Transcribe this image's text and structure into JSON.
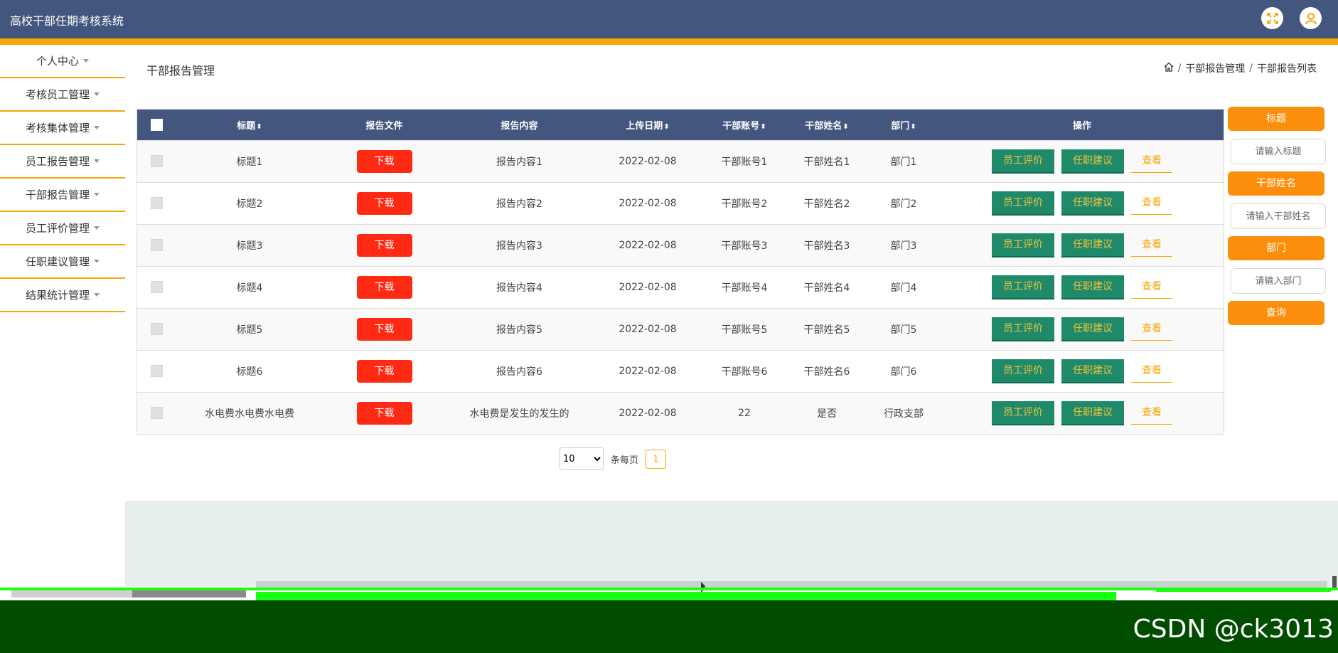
{
  "app": {
    "title": "高校干部任期考核系统"
  },
  "header": {
    "icons": [
      "expand-icon",
      "user-icon"
    ]
  },
  "sidebar": {
    "items": [
      {
        "label": "个人中心"
      },
      {
        "label": "考核员工管理"
      },
      {
        "label": "考核集体管理"
      },
      {
        "label": "员工报告管理"
      },
      {
        "label": "干部报告管理"
      },
      {
        "label": "员工评价管理"
      },
      {
        "label": "任职建议管理"
      },
      {
        "label": "结果统计管理"
      }
    ]
  },
  "page": {
    "title": "干部报告管理",
    "breadcrumb": [
      "干部报告管理",
      "干部报告列表"
    ]
  },
  "table": {
    "headers": {
      "title": "标题",
      "file": "报告文件",
      "content": "报告内容",
      "date": "上传日期",
      "account": "干部账号",
      "name": "干部姓名",
      "dept": "部门",
      "ops": "操作"
    },
    "sort_glyph": "⬍",
    "actions": {
      "download": "下载",
      "evaluate": "员工评价",
      "suggest": "任职建议",
      "view": "查看"
    },
    "rows": [
      {
        "title": "标题1",
        "content": "报告内容1",
        "date": "2022-02-08",
        "account": "干部账号1",
        "name": "干部姓名1",
        "dept": "部门1"
      },
      {
        "title": "标题2",
        "content": "报告内容2",
        "date": "2022-02-08",
        "account": "干部账号2",
        "name": "干部姓名2",
        "dept": "部门2"
      },
      {
        "title": "标题3",
        "content": "报告内容3",
        "date": "2022-02-08",
        "account": "干部账号3",
        "name": "干部姓名3",
        "dept": "部门3"
      },
      {
        "title": "标题4",
        "content": "报告内容4",
        "date": "2022-02-08",
        "account": "干部账号4",
        "name": "干部姓名4",
        "dept": "部门4"
      },
      {
        "title": "标题5",
        "content": "报告内容5",
        "date": "2022-02-08",
        "account": "干部账号5",
        "name": "干部姓名5",
        "dept": "部门5"
      },
      {
        "title": "标题6",
        "content": "报告内容6",
        "date": "2022-02-08",
        "account": "干部账号6",
        "name": "干部姓名6",
        "dept": "部门6"
      },
      {
        "title": "水电费水电费水电费",
        "content": "水电费是发生的发生的",
        "date": "2022-02-08",
        "account": "22",
        "name": "是否",
        "dept": "行政支部"
      }
    ]
  },
  "search": {
    "title_label": "标题",
    "title_placeholder": "请输入标题",
    "name_label": "干部姓名",
    "name_placeholder": "请输入干部姓名",
    "dept_label": "部门",
    "dept_placeholder": "请输入部门",
    "query_button": "查询"
  },
  "pagination": {
    "page_size": "10",
    "per_page_label": "条每页",
    "current_page": "1"
  },
  "watermark": "CSDN @ck3013",
  "colors": {
    "header_bg": "#42567e",
    "accent": "#f6a707",
    "download_red": "#ff2a14",
    "action_green": "#1e8a6a",
    "search_orange": "#fb8f0c"
  }
}
